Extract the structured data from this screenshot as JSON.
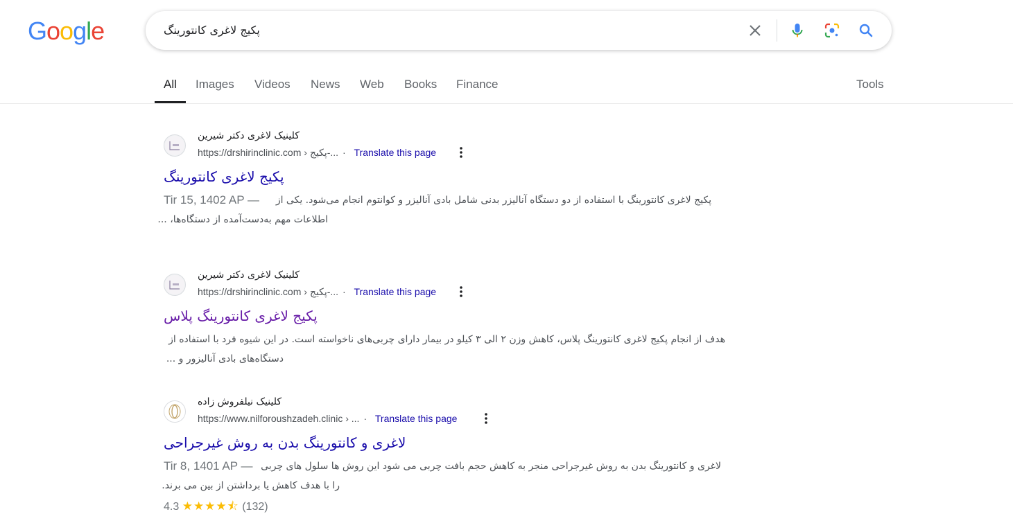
{
  "logo": {
    "letters": [
      "G",
      "o",
      "o",
      "g",
      "l",
      "e"
    ],
    "colors": [
      "#4285F4",
      "#EA4335",
      "#FBBC05",
      "#4285F4",
      "#34A853",
      "#EA4335"
    ]
  },
  "search": {
    "query": "پکیج لاغری کانتورینگ"
  },
  "tabs": [
    {
      "label": "All",
      "active": true
    },
    {
      "label": "Images"
    },
    {
      "label": "Videos"
    },
    {
      "label": "News"
    },
    {
      "label": "Web"
    },
    {
      "label": "Books"
    },
    {
      "label": "Finance"
    }
  ],
  "tools_label": "Tools",
  "results": [
    {
      "site_name": "کلینیک لاغری دکتر شیرین",
      "url": "https://drshirinclinic.com › پکیج-...",
      "translate": "Translate this page",
      "title": "پکیج لاغری کانتورینگ",
      "date": "Tir 15, 1402 AP —",
      "snippet_line1": "پکیج لاغری کانتورینگ با استفاده از دو دستگاه آنالیزر بدنی شامل بادی آنالیزر و کوانتوم انجام می‌شود. یکی از",
      "snippet_line2": "اطلاعات مهم به‌دست‌آمده از دستگاه‌ها، ..."
    },
    {
      "site_name": "کلینیک لاغری دکتر شیرین",
      "url": "https://drshirinclinic.com › پکیج-...",
      "translate": "Translate this page",
      "title": "پکیج لاغری کانتورینگ پلاس",
      "snippet_line1": "هدف از انجام پکیج لاغری کانتورینگ پلاس، کاهش وزن ۲ الی ۳ کیلو در بیمار دارای چربی‌های ناخواسته است. در این شیوه فرد با استفاده از",
      "snippet_line2": "دستگاه‌های بادی آنالیزور و ..."
    },
    {
      "site_name": "کلینیک نیلفروش زاده",
      "url": "https://www.nilforoushzadeh.clinic › ...",
      "translate": "Translate this page",
      "title": "لاغری و کانتورینگ بدن به روش غیرجراحی",
      "date": "Tir 8, 1401 AP —",
      "snippet_line1": "لاغری و کانتورینگ بدن به روش غیرجراحی منجر به کاهش حجم بافت چربی می شود این روش ها سلول های چربی",
      "snippet_line2": "را با هدف کاهش یا برداشتن از بین می برند.",
      "rating_value": "4.3",
      "rating_stars": 4.3,
      "rating_count": "(132)"
    }
  ]
}
